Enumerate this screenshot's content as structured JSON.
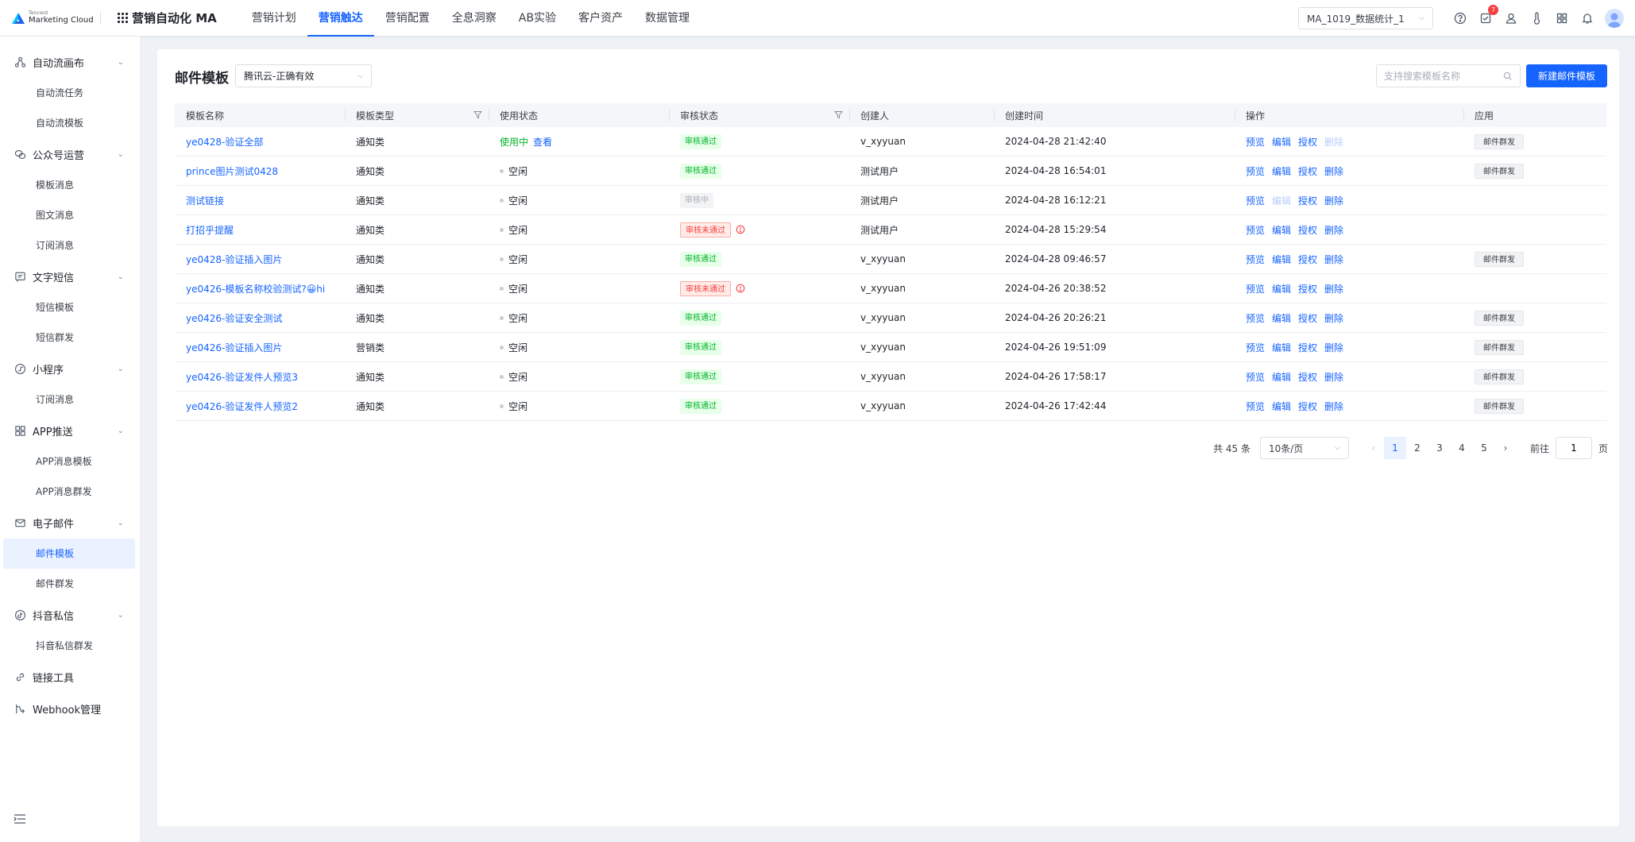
{
  "brand": {
    "small": "Tencent",
    "name": "Marketing Cloud"
  },
  "app": {
    "name": "营销自动化 MA"
  },
  "nav": [
    {
      "label": "营销计划",
      "active": false
    },
    {
      "label": "营销触达",
      "active": true
    },
    {
      "label": "营销配置",
      "active": false
    },
    {
      "label": "全息洞察",
      "active": false
    },
    {
      "label": "AB实验",
      "active": false
    },
    {
      "label": "客户资产",
      "active": false
    },
    {
      "label": "数据管理",
      "active": false
    }
  ],
  "header": {
    "project": "MA_1019_数据统计_1",
    "task_badge": "7",
    "icons": [
      "help-icon",
      "task-icon",
      "user-icon",
      "thermometer-icon",
      "apps-icon",
      "bell-icon",
      "avatar"
    ]
  },
  "sidebar": {
    "groups": [
      {
        "label": "自动流画布",
        "icon": "flow-icon",
        "items": [
          "自动流任务",
          "自动流模板"
        ]
      },
      {
        "label": "公众号运营",
        "icon": "wechat-icon",
        "items": [
          "模板消息",
          "图文消息",
          "订阅消息"
        ]
      },
      {
        "label": "文字短信",
        "icon": "sms-icon",
        "items": [
          "短信模板",
          "短信群发"
        ]
      },
      {
        "label": "小程序",
        "icon": "miniprogram-icon",
        "items": [
          "订阅消息"
        ]
      },
      {
        "label": "APP推送",
        "icon": "app-icon",
        "items": [
          "APP消息模板",
          "APP消息群发"
        ]
      },
      {
        "label": "电子邮件",
        "icon": "mail-icon",
        "items": [
          "邮件模板",
          "邮件群发"
        ]
      },
      {
        "label": "抖音私信",
        "icon": "douyin-icon",
        "items": [
          "抖音私信群发"
        ]
      },
      {
        "label": "链接工具",
        "icon": "link-icon",
        "items": []
      },
      {
        "label": "Webhook管理",
        "icon": "webhook-icon",
        "items": []
      }
    ],
    "active_item": "邮件模板"
  },
  "page": {
    "title": "邮件模板",
    "filter": "腾讯云-正确有效",
    "search_placeholder": "支持搜索模板名称",
    "new_button": "新建邮件模板"
  },
  "table": {
    "columns": [
      "模板名称",
      "模板类型",
      "使用状态",
      "审核状态",
      "创建人",
      "创建时间",
      "操作",
      "应用"
    ],
    "op_labels": [
      "预览",
      "编辑",
      "授权",
      "删除"
    ],
    "in_use_view_label": "查看",
    "apply_label": "邮件群发",
    "rows": [
      {
        "name": "ye0428-验证全部",
        "type": "通知类",
        "usage": "使用中",
        "review": "审核通过",
        "review_kind": "pass",
        "creator": "v_xyyuan",
        "created": "2024-04-28 21:42:40",
        "edit_disabled": false,
        "delete_disabled": true,
        "apply": true
      },
      {
        "name": "prince图片测试0428",
        "type": "通知类",
        "usage": "空闲",
        "review": "审核通过",
        "review_kind": "pass",
        "creator": "测试用户",
        "created": "2024-04-28 16:54:01",
        "edit_disabled": false,
        "delete_disabled": false,
        "apply": true
      },
      {
        "name": "测试链接",
        "type": "通知类",
        "usage": "空闲",
        "review": "审核中",
        "review_kind": "review",
        "creator": "测试用户",
        "created": "2024-04-28 16:12:21",
        "edit_disabled": true,
        "delete_disabled": false,
        "apply": false
      },
      {
        "name": "打招乎提醒",
        "type": "通知类",
        "usage": "空闲",
        "review": "审核未通过",
        "review_kind": "fail",
        "creator": "测试用户",
        "created": "2024-04-28 15:29:54",
        "edit_disabled": false,
        "delete_disabled": false,
        "apply": false
      },
      {
        "name": "ye0428-验证插入图片",
        "type": "通知类",
        "usage": "空闲",
        "review": "审核通过",
        "review_kind": "pass",
        "creator": "v_xyyuan",
        "created": "2024-04-28 09:46:57",
        "edit_disabled": false,
        "delete_disabled": false,
        "apply": true
      },
      {
        "name": "ye0426-模板名称校验测试?😀hi",
        "type": "通知类",
        "usage": "空闲",
        "review": "审核未通过",
        "review_kind": "fail",
        "creator": "v_xyyuan",
        "created": "2024-04-26 20:38:52",
        "edit_disabled": false,
        "delete_disabled": false,
        "apply": false
      },
      {
        "name": "ye0426-验证安全测试",
        "type": "通知类",
        "usage": "空闲",
        "review": "审核通过",
        "review_kind": "pass",
        "creator": "v_xyyuan",
        "created": "2024-04-26 20:26:21",
        "edit_disabled": false,
        "delete_disabled": false,
        "apply": true
      },
      {
        "name": "ye0426-验证插入图片",
        "type": "营销类",
        "usage": "空闲",
        "review": "审核通过",
        "review_kind": "pass",
        "creator": "v_xyyuan",
        "created": "2024-04-26 19:51:09",
        "edit_disabled": false,
        "delete_disabled": false,
        "apply": true
      },
      {
        "name": "ye0426-验证发件人预览3",
        "type": "通知类",
        "usage": "空闲",
        "review": "审核通过",
        "review_kind": "pass",
        "creator": "v_xyyuan",
        "created": "2024-04-26 17:58:17",
        "edit_disabled": false,
        "delete_disabled": false,
        "apply": true
      },
      {
        "name": "ye0426-验证发件人预览2",
        "type": "通知类",
        "usage": "空闲",
        "review": "审核通过",
        "review_kind": "pass",
        "creator": "v_xyyuan",
        "created": "2024-04-26 17:42:44",
        "edit_disabled": false,
        "delete_disabled": false,
        "apply": true
      }
    ]
  },
  "pagination": {
    "total": "共 45 条",
    "page_size": "10条/页",
    "pages": [
      "1",
      "2",
      "3",
      "4",
      "5"
    ],
    "current": "1",
    "goto_label": "前往",
    "goto_value": "1",
    "page_suffix": "页"
  },
  "colors": {
    "primary": "#1664ff",
    "success": "#00b42a",
    "danger": "#f53f3f"
  }
}
